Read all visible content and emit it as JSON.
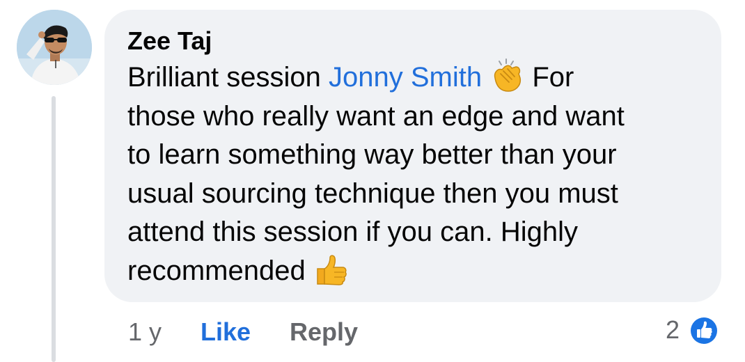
{
  "comment": {
    "author": "Zee Taj",
    "lines": {
      "l1_prefix": "Brilliant session ",
      "l1_mention": "Jonny Smith",
      "l1_suffix": " For",
      "l2": "those who really want an edge and want",
      "l3": "to learn something way better than your",
      "l4": "usual sourcing technique then you must",
      "l5": "attend this session if you can. Highly",
      "l6": "recommended "
    },
    "emojis": [
      "clapping-hands-icon",
      "thumbs-up-icon"
    ]
  },
  "actions": {
    "time": "1 y",
    "like_label": "Like",
    "reply_label": "Reply"
  },
  "reactions": {
    "count": "2",
    "icon": "like-reaction-icon"
  },
  "colors": {
    "bubble": "#f0f2f5",
    "mention": "#216fdb",
    "like": "#216fdb",
    "secondary_text": "#65676b",
    "thread_line": "#dadde1",
    "emoji_yellow": "#f7b625"
  }
}
